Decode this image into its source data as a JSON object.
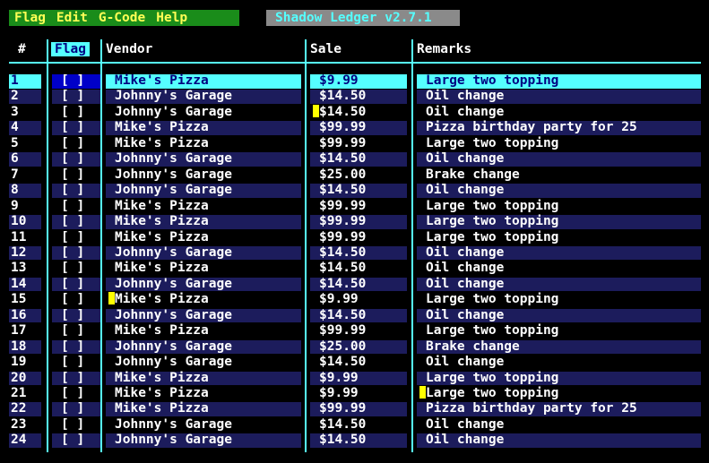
{
  "menu": {
    "items": [
      "Flag",
      "Edit",
      "G-Code",
      "Help"
    ]
  },
  "app_title": "Shadow Ledger v2.7.1",
  "columns": {
    "num": "#",
    "flag": "Flag",
    "vendor": "Vendor",
    "sale": "Sale",
    "remarks": "Remarks"
  },
  "colors": {
    "accent": "#55ffff",
    "menu_bg": "#1a8c1a",
    "menu_text": "#ffff55",
    "row_alt": "#1c1c5c",
    "marker": "#ffff00"
  },
  "rows": [
    {
      "num": "1",
      "flag": "[ ]",
      "vendor": "Mike's Pizza",
      "sale": "$9.99",
      "remarks": "Large two topping"
    },
    {
      "num": "2",
      "flag": "[ ]",
      "vendor": "Johnny's Garage",
      "sale": "$14.50",
      "remarks": "Oil change"
    },
    {
      "num": "3",
      "flag": "[ ]",
      "vendor": "Johnny's Garage",
      "sale": "$14.50",
      "remarks": "Oil change"
    },
    {
      "num": "4",
      "flag": "[ ]",
      "vendor": "Mike's Pizza",
      "sale": "$99.99",
      "remarks": "Pizza birthday party for 25"
    },
    {
      "num": "5",
      "flag": "[ ]",
      "vendor": "Mike's Pizza",
      "sale": "$99.99",
      "remarks": "Large two topping"
    },
    {
      "num": "6",
      "flag": "[ ]",
      "vendor": "Johnny's Garage",
      "sale": "$14.50",
      "remarks": "Oil change"
    },
    {
      "num": "7",
      "flag": "[ ]",
      "vendor": "Johnny's Garage",
      "sale": "$25.00",
      "remarks": "Brake change"
    },
    {
      "num": "8",
      "flag": "[ ]",
      "vendor": "Johnny's Garage",
      "sale": "$14.50",
      "remarks": "Oil change"
    },
    {
      "num": "9",
      "flag": "[ ]",
      "vendor": "Mike's Pizza",
      "sale": "$99.99",
      "remarks": "Large two topping"
    },
    {
      "num": "10",
      "flag": "[ ]",
      "vendor": "Mike's Pizza",
      "sale": "$99.99",
      "remarks": "Large two topping"
    },
    {
      "num": "11",
      "flag": "[ ]",
      "vendor": "Mike's Pizza",
      "sale": "$99.99",
      "remarks": "Large two topping"
    },
    {
      "num": "12",
      "flag": "[ ]",
      "vendor": "Johnny's Garage",
      "sale": "$14.50",
      "remarks": "Oil change"
    },
    {
      "num": "13",
      "flag": "[ ]",
      "vendor": "Mike's Pizza",
      "sale": "$14.50",
      "remarks": "Oil change"
    },
    {
      "num": "14",
      "flag": "[ ]",
      "vendor": "Johnny's Garage",
      "sale": "$14.50",
      "remarks": "Oil change"
    },
    {
      "num": "15",
      "flag": "[ ]",
      "vendor": "Mike's Pizza",
      "sale": "$9.99",
      "remarks": "Large two topping"
    },
    {
      "num": "16",
      "flag": "[ ]",
      "vendor": "Johnny's Garage",
      "sale": "$14.50",
      "remarks": "Oil change"
    },
    {
      "num": "17",
      "flag": "[ ]",
      "vendor": "Mike's Pizza",
      "sale": "$99.99",
      "remarks": "Large two topping"
    },
    {
      "num": "18",
      "flag": "[ ]",
      "vendor": "Johnny's Garage",
      "sale": "$25.00",
      "remarks": "Brake change"
    },
    {
      "num": "19",
      "flag": "[ ]",
      "vendor": "Johnny's Garage",
      "sale": "$14.50",
      "remarks": "Oil change"
    },
    {
      "num": "20",
      "flag": "[ ]",
      "vendor": "Mike's Pizza",
      "sale": "$9.99",
      "remarks": "Large two topping"
    },
    {
      "num": "21",
      "flag": "[ ]",
      "vendor": "Mike's Pizza",
      "sale": "$9.99",
      "remarks": "Large two topping"
    },
    {
      "num": "22",
      "flag": "[ ]",
      "vendor": "Mike's Pizza",
      "sale": "$99.99",
      "remarks": "Pizza birthday party for 25"
    },
    {
      "num": "23",
      "flag": "[ ]",
      "vendor": "Johnny's Garage",
      "sale": "$14.50",
      "remarks": "Oil change"
    },
    {
      "num": "24",
      "flag": "[ ]",
      "vendor": "Johnny's Garage",
      "sale": "$14.50",
      "remarks": "Oil change"
    }
  ],
  "markers": [
    {
      "row": 3,
      "col": "sale"
    },
    {
      "row": 15,
      "col": "vendor"
    },
    {
      "row": 21,
      "col": "remarks"
    }
  ],
  "selected_row": 1
}
